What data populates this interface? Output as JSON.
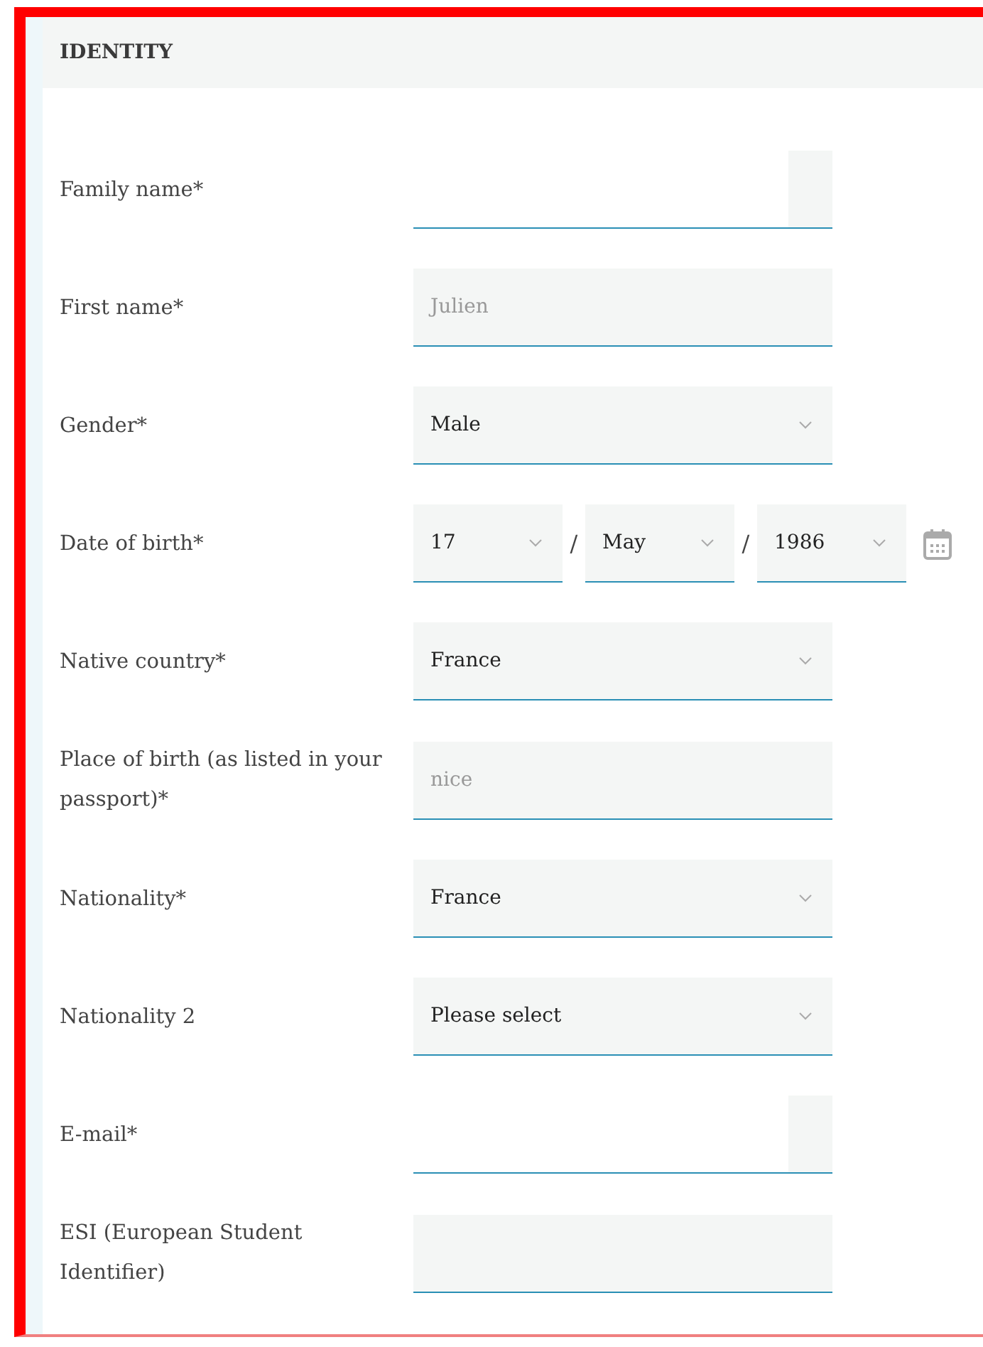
{
  "section": {
    "title": "IDENTITY"
  },
  "fields": [
    {
      "label": "Family name*",
      "kind": "autofill"
    },
    {
      "label": "First name*",
      "kind": "text",
      "value": "Julien",
      "disabled": true
    },
    {
      "label": "Gender*",
      "kind": "select",
      "value": "Male"
    },
    {
      "label": "Date of birth*",
      "kind": "date",
      "parts": [
        {
          "value": "17"
        },
        {
          "value": "May"
        },
        {
          "value": "1986"
        }
      ],
      "separators": [
        "/",
        "/"
      ]
    },
    {
      "label": "Native country*",
      "kind": "select",
      "value": "France"
    },
    {
      "label": "Place of birth (as listed in your passport)*",
      "kind": "text",
      "value": "nice",
      "disabled": true
    },
    {
      "label": "Nationality*",
      "kind": "select",
      "value": "France"
    },
    {
      "label": "Nationality 2",
      "kind": "select",
      "value": "Please select"
    },
    {
      "label": "E-mail*",
      "kind": "autofill"
    },
    {
      "label": "ESI (European Student Identifier)",
      "kind": "text"
    }
  ]
}
